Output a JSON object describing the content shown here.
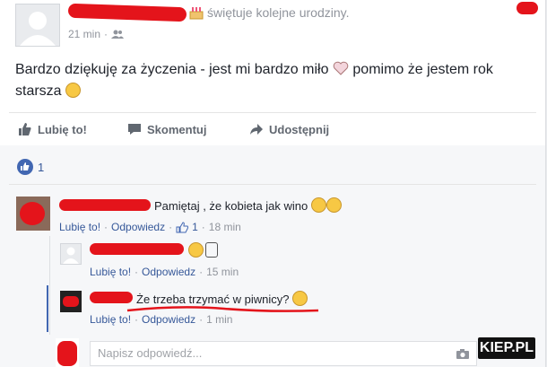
{
  "post": {
    "header_suffix": "świętuje kolejne urodziny.",
    "time": "21 min",
    "message": "Bardzo dziękuję za życzenia - jest mi bardzo miło",
    "message_end": " pomimo że jestem rok starsza"
  },
  "actions": {
    "like": "Lubię to!",
    "comment": "Skomentuj",
    "share": "Udostępnij"
  },
  "reactions": {
    "count": "1"
  },
  "comments": [
    {
      "text": "Pamiętaj , że kobieta jak wino",
      "like": "Lubię to!",
      "reply": "Odpowiedz",
      "likes": "1",
      "time": "18 min"
    }
  ],
  "replies": [
    {
      "like": "Lubię to!",
      "reply": "Odpowiedz",
      "time": "15 min"
    },
    {
      "text": "Że trzeba trzymać w piwnicy?",
      "like": "Lubię to!",
      "reply": "Odpowiedz",
      "time": "1 min"
    }
  ],
  "reply_box": {
    "placeholder": "Napisz odpowiedź..."
  },
  "watermark": "KIEP.PL",
  "colors": {
    "fb_blue": "#4267b2",
    "link_blue": "#365899",
    "scribble_red": "#e4141b"
  }
}
